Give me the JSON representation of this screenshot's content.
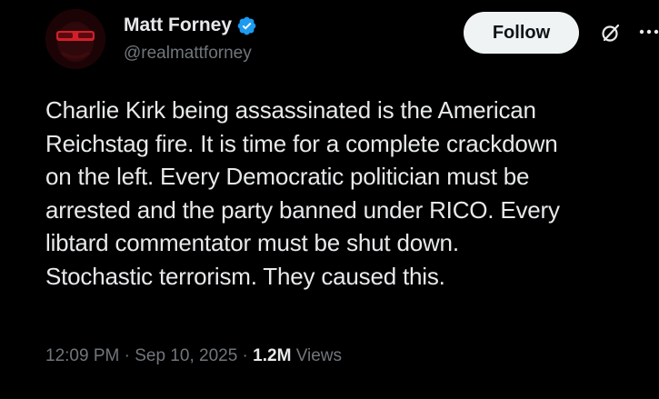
{
  "user": {
    "display_name": "Matt Forney",
    "handle": "@realmattforney"
  },
  "actions": {
    "follow_label": "Follow"
  },
  "tweet": {
    "text": "Charlie Kirk being assassinated is the American\nReichstag fire. It is time for a complete crackdown\non the left. Every Democratic politician must be\narrested and the party banned under RICO. Every\nlibtard commentator must be shut down.\nStochastic terrorism. They caused this.",
    "time": "12:09 PM",
    "date": "Sep 10, 2025",
    "separator": "·",
    "views_count": "1.2M",
    "views_label": "Views"
  },
  "icons": {
    "verified": "verified-badge-icon",
    "grok": "grok-icon",
    "more": "more-icon"
  },
  "colors": {
    "background": "#000000",
    "text_primary": "#e7e9ea",
    "text_secondary": "#71767b",
    "verified_blue": "#1d9bf0",
    "follow_bg": "#eff3f4"
  }
}
